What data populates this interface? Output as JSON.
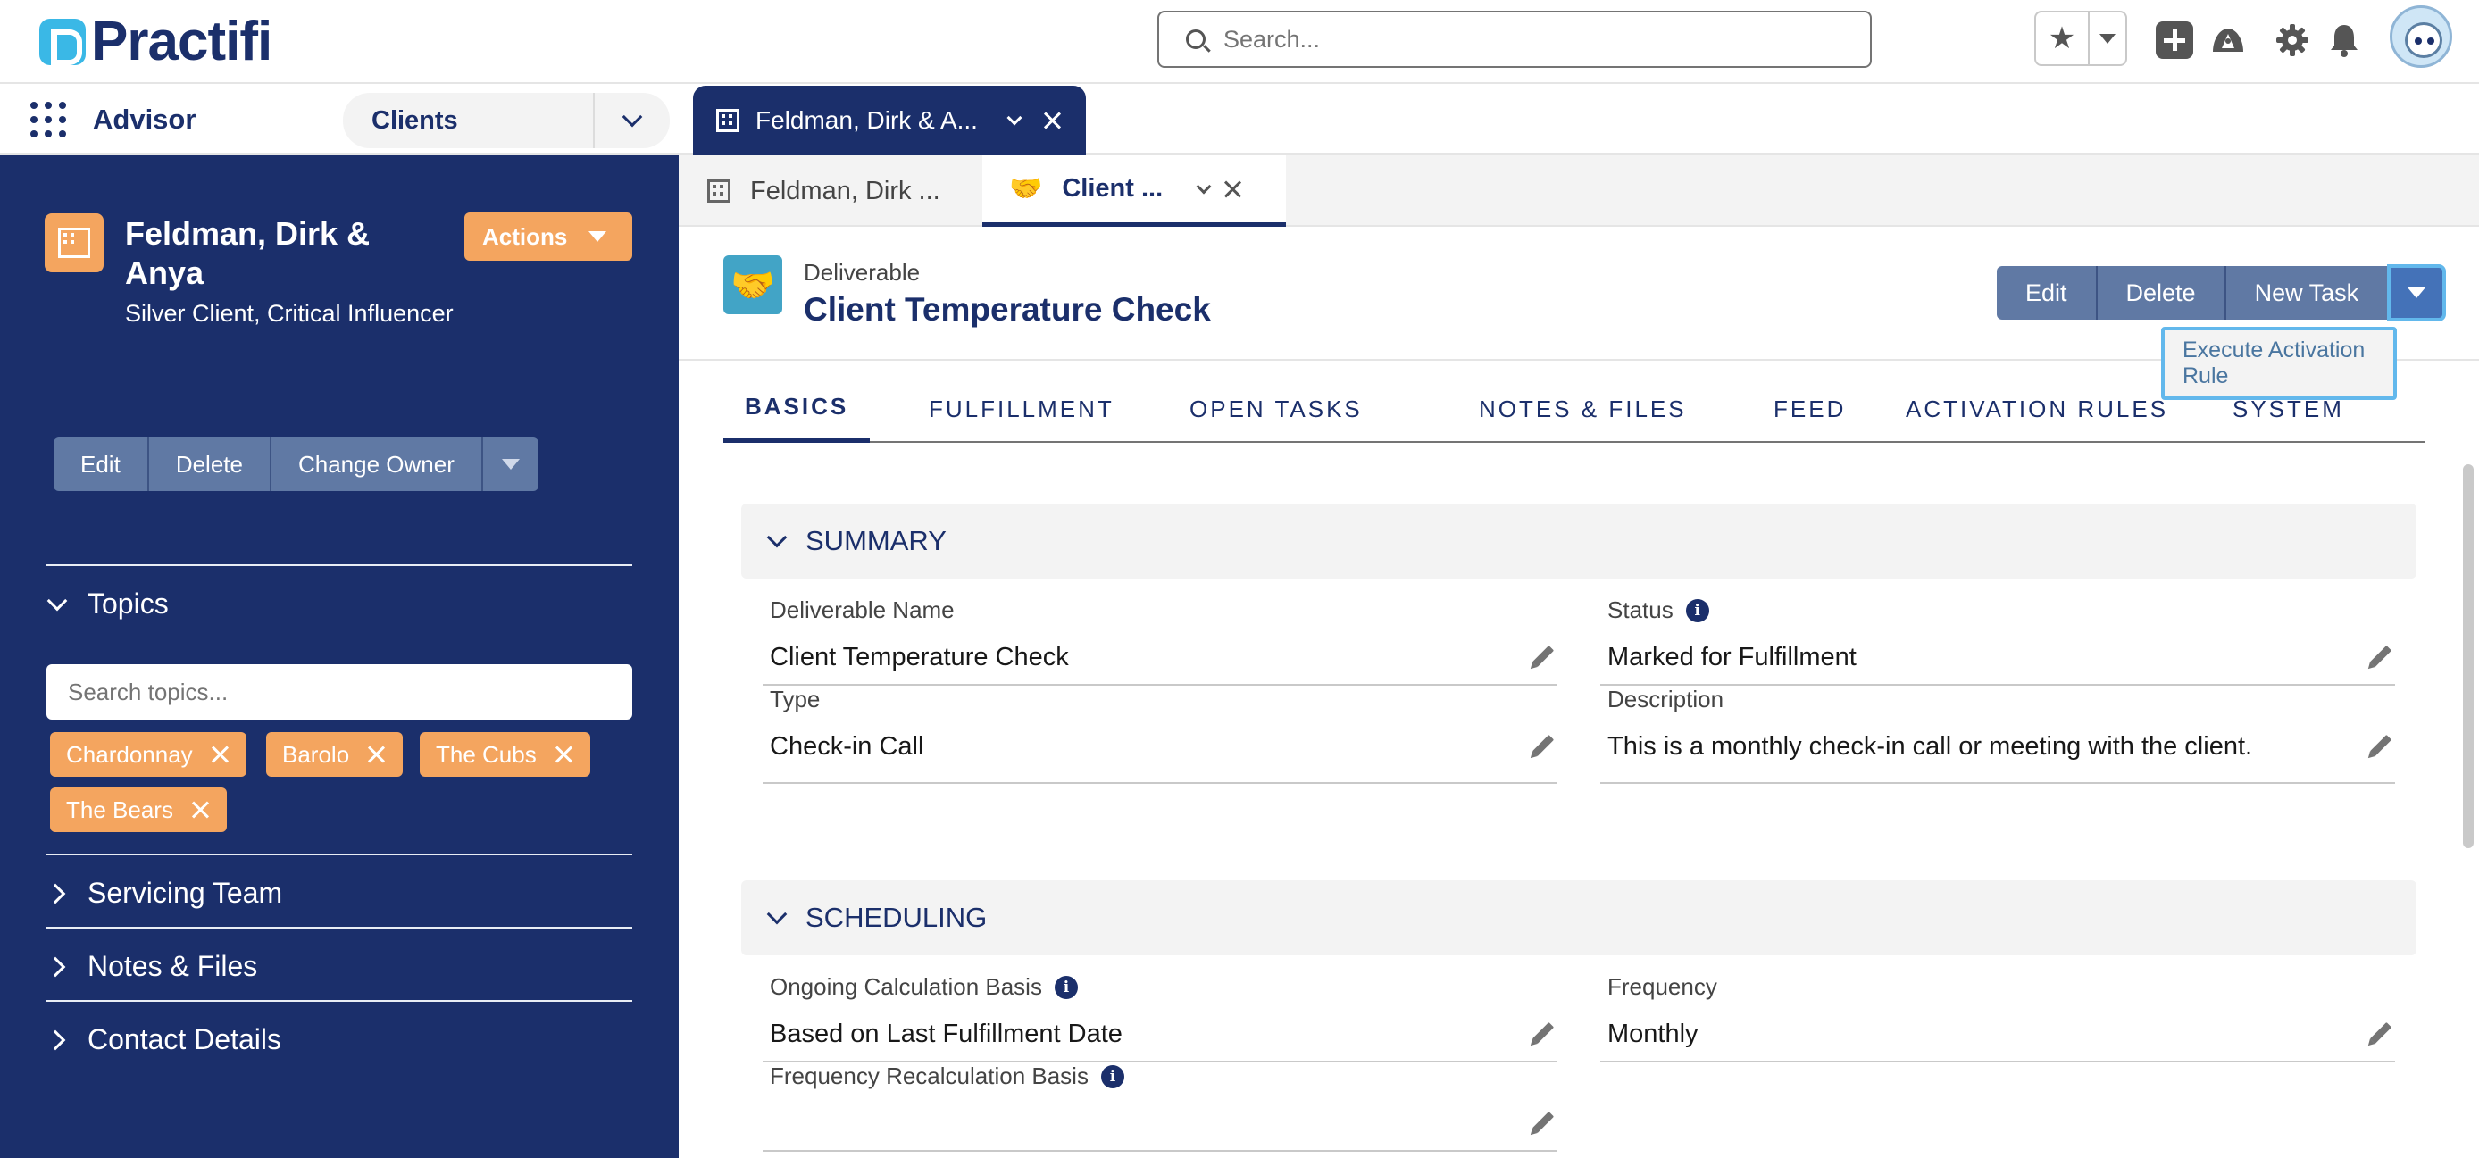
{
  "header": {
    "logo_text": "Practifi",
    "search_placeholder": "Search...",
    "icons": [
      "star-icon",
      "chevron-down-icon",
      "plus-icon",
      "trailhead-icon",
      "gear-icon",
      "bell-icon",
      "avatar"
    ]
  },
  "nav": {
    "app_name": "Advisor",
    "object_select": "Clients",
    "workspace_tab": "Feldman, Dirk & A..."
  },
  "sidebar": {
    "account_name": "Feldman, Dirk & Anya",
    "account_sub": "Silver Client, Critical Influencer",
    "actions_label": "Actions",
    "buttons": [
      "Edit",
      "Delete",
      "Change Owner"
    ],
    "topics_label": "Topics",
    "topic_search_placeholder": "Search topics...",
    "topics": [
      "Chardonnay",
      "Barolo",
      "The Cubs",
      "The Bears"
    ],
    "sections": [
      "Servicing Team",
      "Notes & Files",
      "Contact Details"
    ]
  },
  "subtabs": [
    {
      "label": "Feldman, Dirk ..."
    },
    {
      "label": "Client ..."
    }
  ],
  "record": {
    "type": "Deliverable",
    "title": "Client Temperature Check",
    "buttons": [
      "Edit",
      "Delete",
      "New Task"
    ],
    "dropdown_item": "Execute Activation Rule",
    "tabs": [
      "BASICS",
      "FULFILLMENT",
      "OPEN TASKS",
      "NOTES & FILES",
      "FEED",
      "ACTIVATION RULES",
      "SYSTEM"
    ]
  },
  "summary": {
    "title": "SUMMARY",
    "fields": [
      {
        "label": "Deliverable Name",
        "value": "Client Temperature Check"
      },
      {
        "label": "Status",
        "value": "Marked for Fulfillment"
      },
      {
        "label": "Type",
        "value": "Check-in Call"
      },
      {
        "label": "Description",
        "value": "This is a monthly check-in call or meeting with the client."
      }
    ]
  },
  "scheduling": {
    "title": "SCHEDULING",
    "fields": [
      {
        "label": "Ongoing Calculation Basis",
        "value": "Based on Last Fulfillment Date"
      },
      {
        "label": "Frequency",
        "value": "Monthly"
      },
      {
        "label": "Frequency Recalculation Basis",
        "value": ""
      }
    ]
  },
  "colors": {
    "navy": "#1b2f6b",
    "orange": "#f4a55f",
    "button_blue": "#6079a4",
    "teal": "#42a4c6",
    "highlight": "#62b8ec"
  }
}
